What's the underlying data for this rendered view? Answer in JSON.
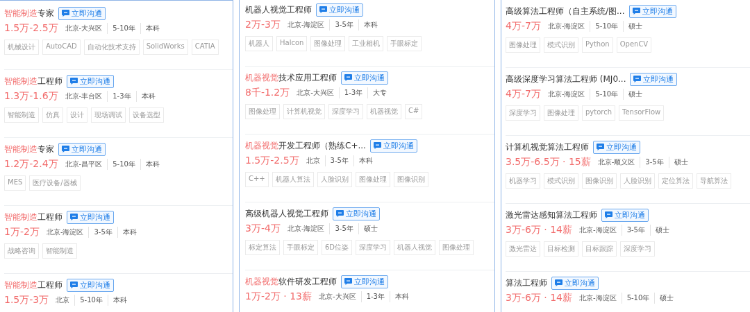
{
  "columns": [
    {
      "jobs": [
        {
          "title": [
            {
              "text": "智能制造",
              "highlight": true
            },
            {
              "text": "专家",
              "highlight": false
            }
          ],
          "chat": "立即沟通",
          "salary": "1.5万-2.5万",
          "meta": [
            "北京-大兴区",
            "5-10年",
            "本科"
          ],
          "tags": [
            "机械设计",
            "AutoCAD",
            "自动化技术支持",
            "SolidWorks",
            "CATIA"
          ]
        },
        {
          "title": [
            {
              "text": "智能制造",
              "highlight": true
            },
            {
              "text": "工程师",
              "highlight": false
            }
          ],
          "chat": "立即沟通",
          "salary": "1.3万-1.6万",
          "meta": [
            "北京-丰台区",
            "1-3年",
            "本科"
          ],
          "tags": [
            "智能制造",
            "仿真",
            "设计",
            "现场调试",
            "设备选型"
          ]
        },
        {
          "title": [
            {
              "text": "智能制造",
              "highlight": true
            },
            {
              "text": "专家",
              "highlight": false
            }
          ],
          "chat": "立即沟通",
          "salary": "1.2万-2.4万",
          "meta": [
            "北京-昌平区",
            "5-10年",
            "本科"
          ],
          "tags": [
            "MES",
            "医疗设备/器械"
          ]
        },
        {
          "title": [
            {
              "text": "智能制造",
              "highlight": true
            },
            {
              "text": "工程师",
              "highlight": false
            }
          ],
          "chat": "立即沟通",
          "salary": "1万-2万",
          "meta": [
            "北京-海淀区",
            "3-5年",
            "本科"
          ],
          "tags": [
            "战略咨询",
            "智能制造"
          ]
        },
        {
          "title": [
            {
              "text": "智能制造",
              "highlight": true
            },
            {
              "text": "工程师",
              "highlight": false
            }
          ],
          "chat": "立即沟通",
          "salary": "1.5万-3万",
          "meta": [
            "北京",
            "5-10年",
            "本科"
          ]
        }
      ]
    },
    {
      "jobs": [
        {
          "title": [
            {
              "text": "机器人视觉工程师",
              "highlight": false
            }
          ],
          "chat": "立即沟通",
          "salary": "2万-3万",
          "meta": [
            "北京-海淀区",
            "3-5年",
            "本科"
          ],
          "tags": [
            "机器人",
            "Halcon",
            "图像处理",
            "工业相机",
            "手眼标定"
          ]
        },
        {
          "title": [
            {
              "text": "机器视觉",
              "highlight": true
            },
            {
              "text": "技术应用工程师",
              "highlight": false
            }
          ],
          "chat": "立即沟通",
          "salary": "8千-1.2万",
          "meta": [
            "北京-大兴区",
            "1-3年",
            "大专"
          ],
          "tags": [
            "图像处理",
            "计算机视觉",
            "深度学习",
            "机器视觉",
            "C#"
          ]
        },
        {
          "title": [
            {
              "text": "机器视觉",
              "highlight": true
            },
            {
              "text": "开发工程师（熟练C+...",
              "highlight": false
            }
          ],
          "chat": "立即沟通",
          "salary": "1.5万-2.5万",
          "meta": [
            "北京",
            "3-5年",
            "本科"
          ],
          "tags": [
            "C++",
            "机器人算法",
            "人脸识别",
            "图像处理",
            "图像识别"
          ]
        },
        {
          "title": [
            {
              "text": "高级机器人视觉工程师",
              "highlight": false
            }
          ],
          "chat": "立即沟通",
          "salary": "3万-4万",
          "meta": [
            "北京-海淀区",
            "3-5年",
            "硕士"
          ],
          "tags": [
            "标定算法",
            "手眼标定",
            "6D位姿",
            "深度学习",
            "机器人视觉",
            "图像处理"
          ]
        },
        {
          "title": [
            {
              "text": "机器视觉",
              "highlight": true
            },
            {
              "text": "软件研发工程师",
              "highlight": false
            }
          ],
          "chat": "立即沟通",
          "salary": "1万-2万 · 13薪",
          "meta": [
            "北京-大兴区",
            "1-3年",
            "本科"
          ]
        }
      ]
    },
    {
      "jobs": [
        {
          "title": [
            {
              "text": "高级算法工程师（自主系统/图...",
              "highlight": false
            }
          ],
          "chat": "立即沟通",
          "salary": "4万-7万",
          "meta": [
            "北京-海淀区",
            "5-10年",
            "硕士"
          ],
          "tags": [
            "图像处理",
            "模式识别",
            "Python",
            "OpenCV"
          ]
        },
        {
          "title": [
            {
              "text": "高级深度学习算法工程师 (MJ0...",
              "highlight": false
            }
          ],
          "chat": "立即沟通",
          "salary": "4万-7万",
          "meta": [
            "北京-海淀区",
            "5-10年",
            "硕士"
          ],
          "tags": [
            "深度学习",
            "图像处理",
            "pytorch",
            "TensorFlow"
          ]
        },
        {
          "title": [
            {
              "text": "计算机视觉算法工程师",
              "highlight": false
            }
          ],
          "chat": "立即沟通",
          "salary": "3.5万-6.5万 · 15薪",
          "meta": [
            "北京-顺义区",
            "3-5年",
            "硕士"
          ],
          "tags": [
            "机器学习",
            "模式识别",
            "图像识别",
            "人脸识别",
            "定位算法",
            "导航算法"
          ]
        },
        {
          "title": [
            {
              "text": "激光雷达感知算法工程师",
              "highlight": false
            }
          ],
          "chat": "立即沟通",
          "salary": "3万-6万 · 14薪",
          "meta": [
            "北京-海淀区",
            "3-5年",
            "硕士"
          ],
          "tags": [
            "激光雷达",
            "目标检测",
            "目标跟踪",
            "深度学习"
          ]
        },
        {
          "title": [
            {
              "text": "算法工程师",
              "highlight": false
            }
          ],
          "chat": "立即沟通",
          "salary": "3万-6万 · 14薪",
          "meta": [
            "北京-海淀区",
            "5-10年",
            "硕士"
          ]
        }
      ]
    }
  ]
}
